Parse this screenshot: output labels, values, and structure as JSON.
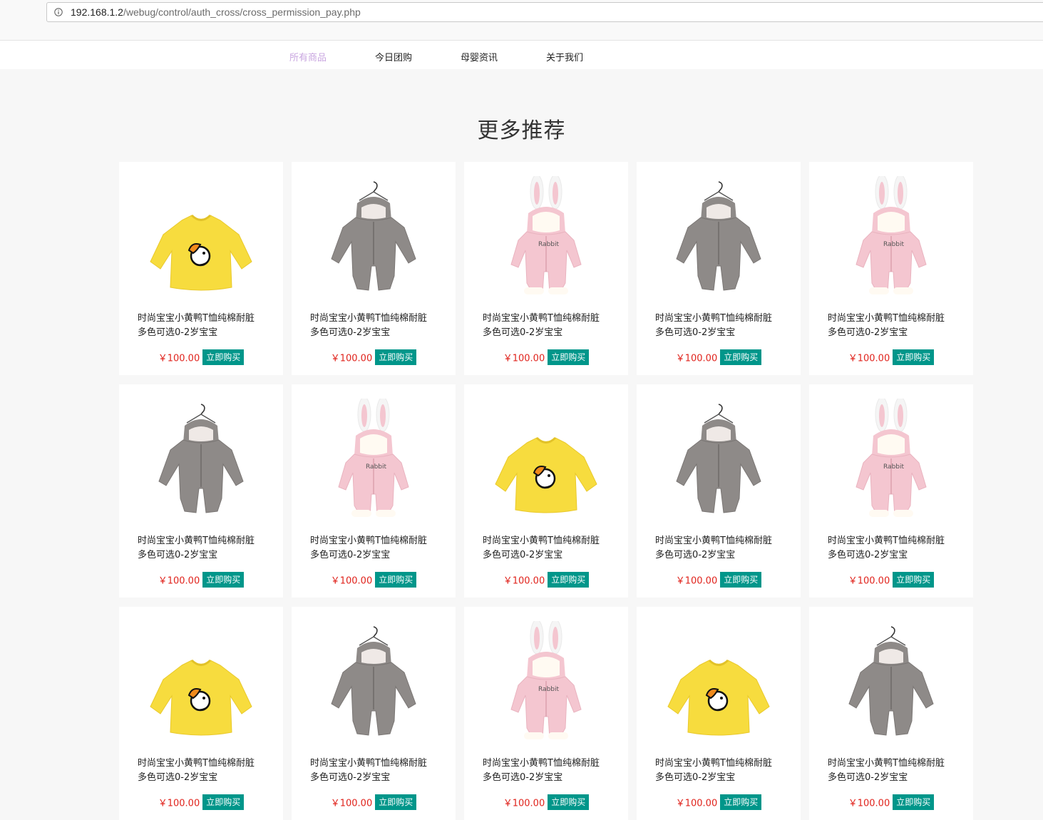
{
  "browser": {
    "url_host": "192.168.1.2",
    "url_path": "/webug/control/auth_cross/cross_permission_pay.php"
  },
  "nav": {
    "items": [
      "所有商品",
      "今日团购",
      "母婴资讯",
      "关于我们"
    ],
    "active": "所有商品"
  },
  "section_title": "更多推荐",
  "product_name_line1": "时尚宝宝小黄鸭T恤纯棉耐脏",
  "product_name_line2": "多色可选0-2岁宝宝",
  "price": "￥100.00",
  "buy_label": "立即购买",
  "colors": {
    "accent_button": "#00968a",
    "price": "#e0231c",
    "nav_active": "#c9a6e0",
    "yellow_shirt": "#f7dc3e",
    "gray_romper": "#8e8a88",
    "pink_romper": "#f4c6d0"
  },
  "products": [
    {
      "image": "yellow-duck-shirt"
    },
    {
      "image": "gray-fleece-romper"
    },
    {
      "image": "pink-bunny-romper"
    },
    {
      "image": "gray-fleece-romper"
    },
    {
      "image": "pink-bunny-romper"
    },
    {
      "image": "gray-fleece-romper"
    },
    {
      "image": "pink-bunny-romper"
    },
    {
      "image": "yellow-duck-shirt"
    },
    {
      "image": "gray-fleece-romper"
    },
    {
      "image": "pink-bunny-romper"
    },
    {
      "image": "yellow-duck-shirt"
    },
    {
      "image": "gray-fleece-romper"
    },
    {
      "image": "pink-bunny-romper"
    },
    {
      "image": "yellow-duck-shirt"
    },
    {
      "image": "gray-fleece-romper"
    }
  ]
}
